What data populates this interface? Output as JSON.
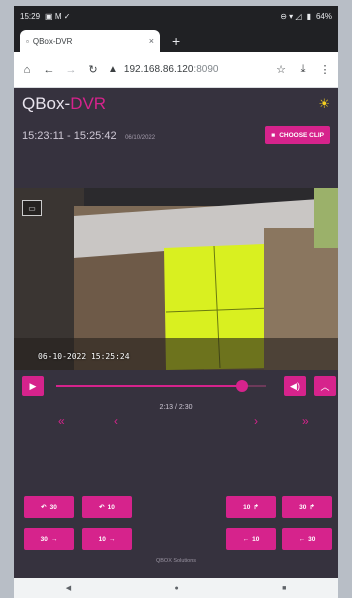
{
  "status": {
    "time": "15:29",
    "icons_left": "▣ M ✓",
    "battery": "64%",
    "icons_right": "⊖ ▾ ◿"
  },
  "browser": {
    "tab_title": "QBox-DVR",
    "tab_close": "×",
    "new_tab": "+",
    "url": "192.168.86.120",
    "port": ":8090"
  },
  "app": {
    "brand": "QBox-",
    "brand_accent": "DVR",
    "time_range": "15:23:11 - 15:25:42",
    "date": "06/10/2022",
    "choose_clip": "CHOOSE CLIP",
    "video_timestamp": "06-10-2022 15:25:24",
    "progress_text": "2:13 / 2:30",
    "progress_fraction": 0.887,
    "footer": "QBOX Solutions"
  },
  "playback": {
    "left_buttons": [
      {
        "label": "30",
        "icon": "↶"
      },
      {
        "label": "10",
        "icon": "↶"
      },
      {
        "label": "30",
        "icon": "→"
      },
      {
        "label": "10",
        "icon": "→"
      }
    ],
    "right_buttons": [
      {
        "label": "10",
        "icon": "↱"
      },
      {
        "label": "30",
        "icon": "↱"
      },
      {
        "label": "10",
        "icon": "←"
      },
      {
        "label": "30",
        "icon": "←"
      }
    ]
  },
  "colors": {
    "accent": "#d6238c",
    "background": "#36323e",
    "sun": "#f5d020"
  }
}
